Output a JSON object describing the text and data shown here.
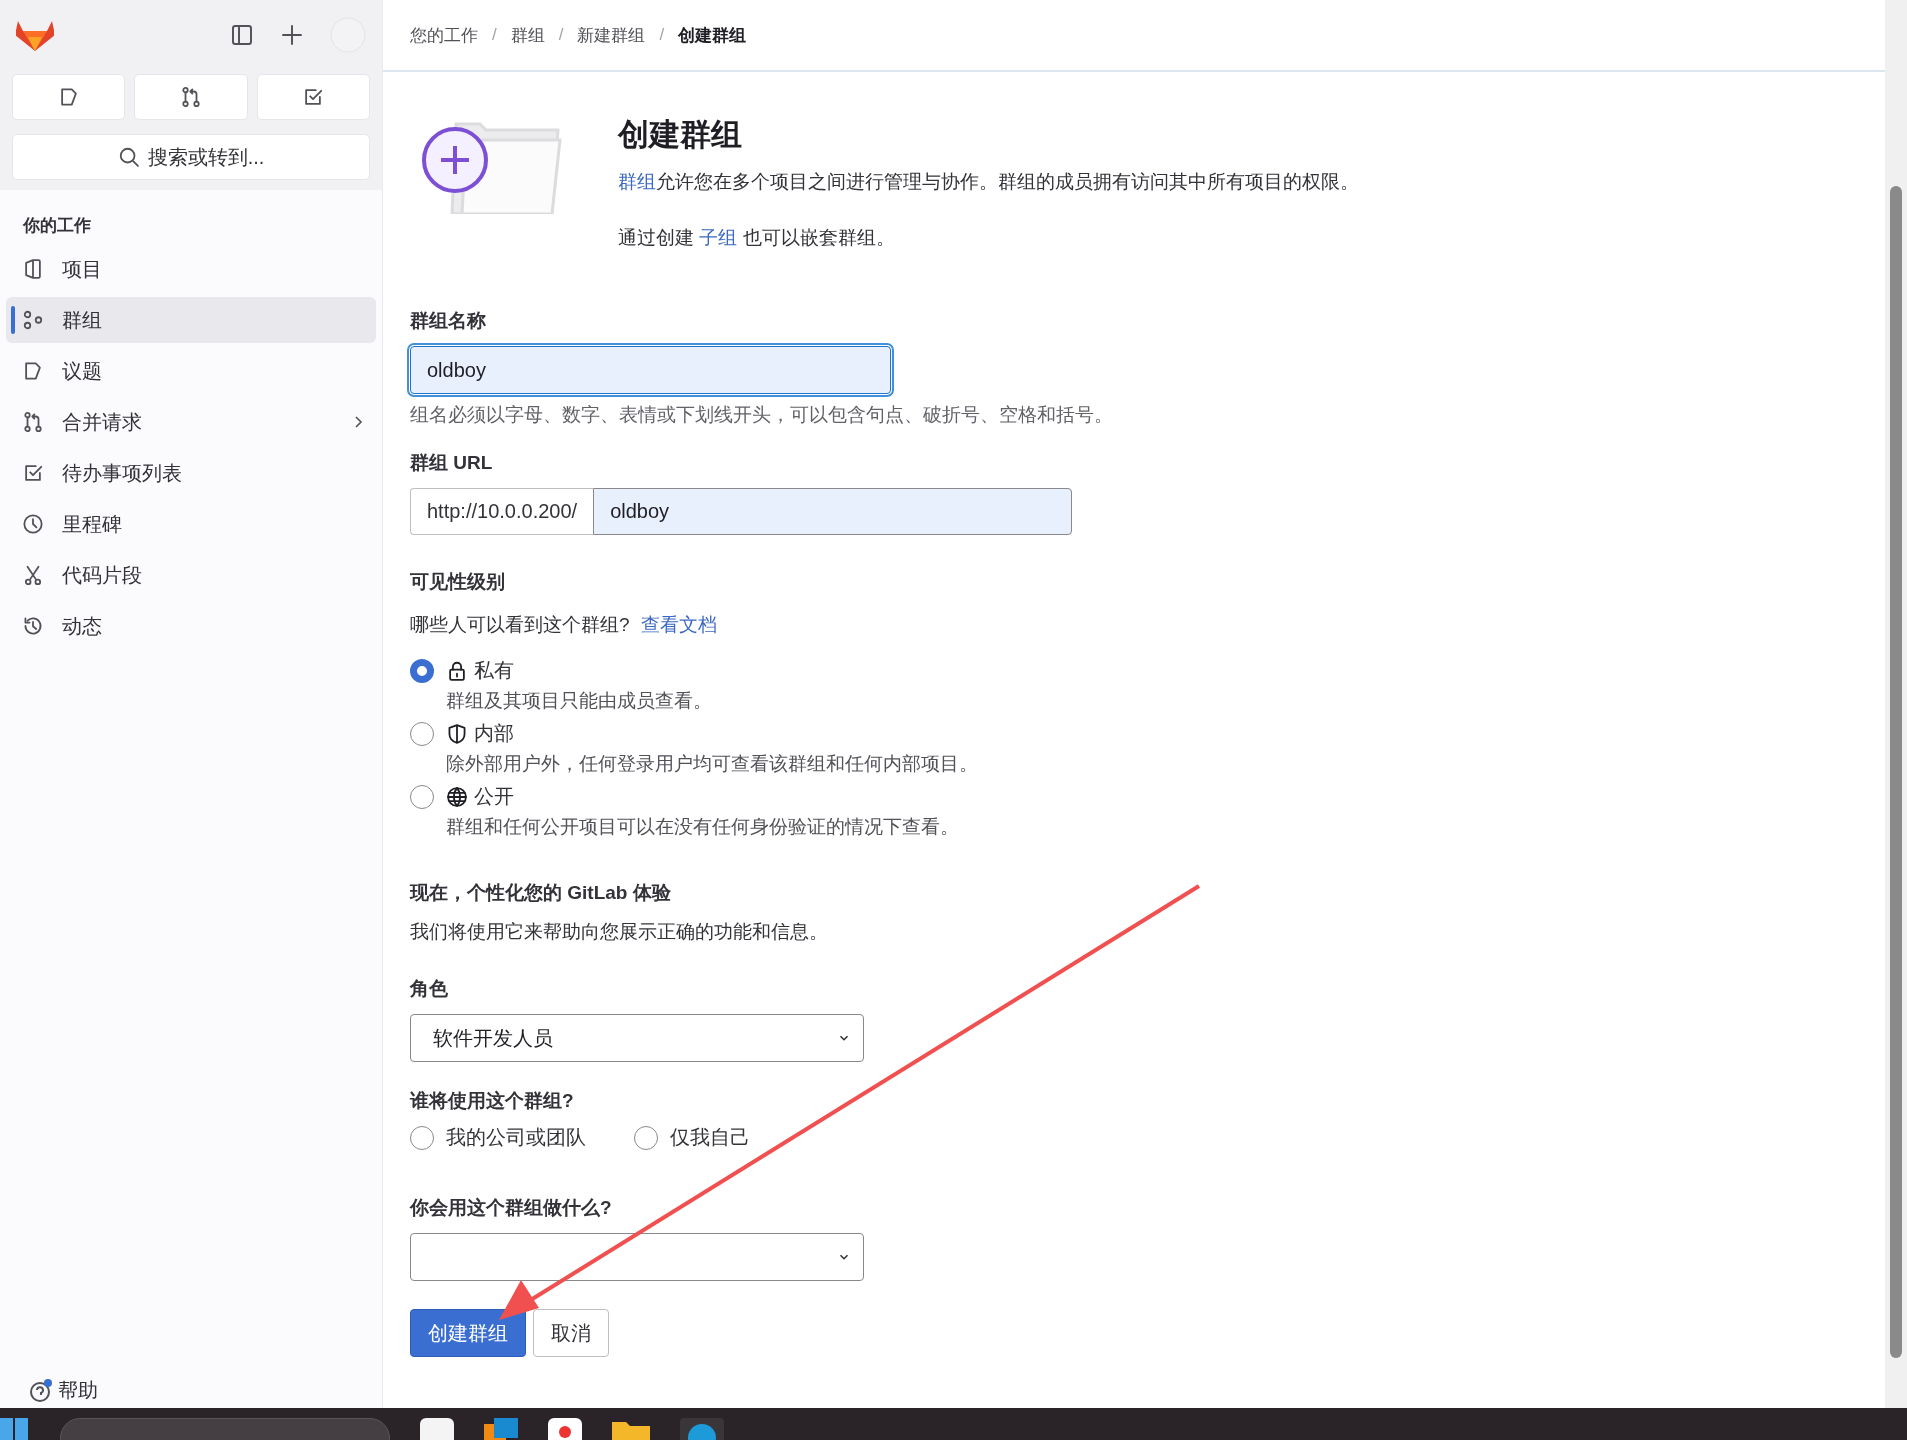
{
  "search_button": {
    "label": "搜索或转到..."
  },
  "sidebar": {
    "section_title": "你的工作",
    "items": [
      {
        "label": "项目",
        "selected": false,
        "expandable": false
      },
      {
        "label": "群组",
        "selected": true,
        "expandable": false
      },
      {
        "label": "议题",
        "selected": false,
        "expandable": false
      },
      {
        "label": "合并请求",
        "selected": false,
        "expandable": true
      },
      {
        "label": "待办事项列表",
        "selected": false,
        "expandable": false
      },
      {
        "label": "里程碑",
        "selected": false,
        "expandable": false
      },
      {
        "label": "代码片段",
        "selected": false,
        "expandable": false
      },
      {
        "label": "动态",
        "selected": false,
        "expandable": false
      }
    ],
    "help": {
      "label": "帮助",
      "has_notification": true
    }
  },
  "breadcrumb_separator": "/",
  "breadcrumbs": [
    {
      "label": "您的工作",
      "current": false
    },
    {
      "label": "群组",
      "current": false
    },
    {
      "label": "新建群组",
      "current": false
    },
    {
      "label": "创建群组",
      "current": true
    }
  ],
  "header": {
    "title": "创建群组",
    "description": {
      "link": "群组",
      "text": "允许您在多个项目之间进行管理与协作。群组的成员拥有访问其中所有项目的权限。"
    },
    "nested_note": {
      "before": "通过创建",
      "link": "子组",
      "after": "也可以嵌套群组。"
    }
  },
  "form": {
    "group_name": {
      "label": "群组名称",
      "value": "oldboy",
      "focused": true,
      "help": "组名必须以字母、数字、表情或下划线开头，可以包含句点、破折号、空格和括号。"
    },
    "group_url": {
      "label": "群组 URL",
      "prefix": "http://10.0.0.200/",
      "value": "oldboy"
    },
    "visibility": {
      "label": "可见性级别",
      "question": "哪些人可以看到这个群组?",
      "doc_link": "查看文档",
      "options": [
        {
          "kind": "lock",
          "label": "私有",
          "description": "群组及其项目只能由成员查看。",
          "selected": true
        },
        {
          "kind": "shield",
          "label": "内部",
          "description": "除外部用户外，任何登录用户均可查看该群组和任何内部项目。",
          "selected": false
        },
        {
          "kind": "globe",
          "label": "公开",
          "description": "群组和任何公开项目可以在没有任何身份验证的情况下查看。",
          "selected": false
        }
      ]
    },
    "personalize": {
      "title": "现在，个性化您的 GitLab 体验",
      "description": "我们将使用它来帮助向您展示正确的功能和信息。"
    },
    "role": {
      "label": "角色",
      "value": "软件开发人员"
    },
    "audience": {
      "label": "谁将使用这个群组?",
      "options": [
        {
          "label": "我的公司或团队",
          "selected": false
        },
        {
          "label": "仅我自己",
          "selected": false
        }
      ]
    },
    "purpose": {
      "label": "你会用这个群组做什么?"
    },
    "buttons": [
      {
        "label": "创建群组",
        "kind": "primary"
      },
      {
        "label": "取消",
        "kind": "secondary"
      }
    ]
  }
}
